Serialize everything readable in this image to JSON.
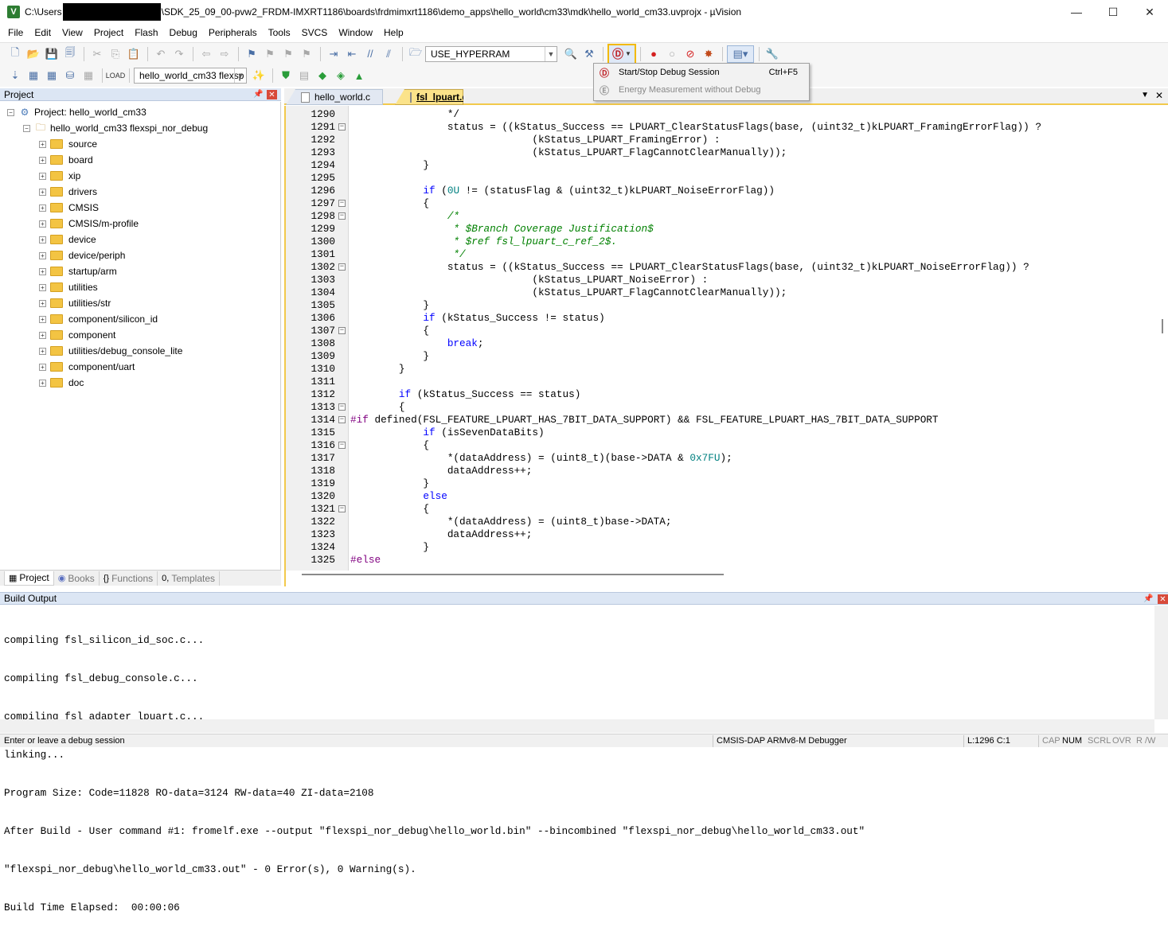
{
  "window": {
    "title_prefix": "C:\\Users",
    "title_suffix": "\\SDK_25_09_00-pvw2_FRDM-IMXRT1186\\boards\\frdmimxrt1186\\demo_apps\\hello_world\\cm33\\mdk\\hello_world_cm33.uvprojx - µVision",
    "icon": "V",
    "minimize": "—",
    "maximize": "☐",
    "close": "✕"
  },
  "menu": [
    "File",
    "Edit",
    "View",
    "Project",
    "Flash",
    "Debug",
    "Peripherals",
    "Tools",
    "SVCS",
    "Window",
    "Help"
  ],
  "toolbar": {
    "define_combo": "USE_HYPERRAM",
    "target_combo": "hello_world_cm33 flexsp"
  },
  "debug_menu": {
    "items": [
      {
        "label": "Start/Stop Debug Session",
        "shortcut": "Ctrl+F5"
      },
      {
        "label": "Energy Measurement without Debug",
        "shortcut": ""
      }
    ]
  },
  "project_panel": {
    "title": "Project",
    "project_label": "Project: hello_world_cm33",
    "target_label": "hello_world_cm33 flexspi_nor_debug",
    "groups": [
      "source",
      "board",
      "xip",
      "drivers",
      "CMSIS",
      "CMSIS/m-profile",
      "device",
      "device/periph",
      "startup/arm",
      "utilities",
      "utilities/str",
      "component/silicon_id",
      "component",
      "utilities/debug_console_lite",
      "component/uart",
      "doc"
    ],
    "tabs": [
      "Project",
      "Books",
      "Functions",
      "Templates"
    ]
  },
  "editor": {
    "tabs": [
      "hello_world.c",
      "fsl_lpuart.c"
    ],
    "lines": [
      {
        "n": "1290",
        "f": "",
        "h": [
          [
            "",
            "                */"
          ]
        ]
      },
      {
        "n": "1291",
        "f": "-",
        "h": [
          [
            "",
            "                status = ((kStatus_Success == LPUART_ClearStatusFlags(base, (uint32_t)kLPUART_FramingErrorFlag)) ?"
          ]
        ]
      },
      {
        "n": "1292",
        "f": "",
        "h": [
          [
            "",
            "                              (kStatus_LPUART_FramingError) :"
          ]
        ]
      },
      {
        "n": "1293",
        "f": "",
        "h": [
          [
            "",
            "                              (kStatus_LPUART_FlagCannotClearManually));"
          ]
        ]
      },
      {
        "n": "1294",
        "f": "",
        "h": [
          [
            "",
            "            }"
          ]
        ]
      },
      {
        "n": "1295",
        "f": "",
        "h": [
          [
            "",
            ""
          ]
        ]
      },
      {
        "n": "1296",
        "f": "",
        "h": [
          [
            "kw",
            "            if"
          ],
          [
            "",
            " ("
          ],
          [
            "num",
            "0U"
          ],
          [
            "",
            " != (statusFlag & (uint32_t)kLPUART_NoiseErrorFlag))"
          ]
        ]
      },
      {
        "n": "1297",
        "f": "-",
        "h": [
          [
            "",
            "            {"
          ]
        ]
      },
      {
        "n": "1298",
        "f": "-",
        "h": [
          [
            "cm",
            "                /*"
          ]
        ]
      },
      {
        "n": "1299",
        "f": "",
        "h": [
          [
            "cm",
            "                 * $Branch Coverage Justification$"
          ]
        ]
      },
      {
        "n": "1300",
        "f": "",
        "h": [
          [
            "cm",
            "                 * $ref fsl_lpuart_c_ref_2$."
          ]
        ]
      },
      {
        "n": "1301",
        "f": "",
        "h": [
          [
            "cm",
            "                 */"
          ]
        ]
      },
      {
        "n": "1302",
        "f": "-",
        "h": [
          [
            "",
            "                status = ((kStatus_Success == LPUART_ClearStatusFlags(base, (uint32_t)kLPUART_NoiseErrorFlag)) ?"
          ]
        ]
      },
      {
        "n": "1303",
        "f": "",
        "h": [
          [
            "",
            "                              (kStatus_LPUART_NoiseError) :"
          ]
        ]
      },
      {
        "n": "1304",
        "f": "",
        "h": [
          [
            "",
            "                              (kStatus_LPUART_FlagCannotClearManually));"
          ]
        ]
      },
      {
        "n": "1305",
        "f": "",
        "h": [
          [
            "",
            "            }"
          ]
        ]
      },
      {
        "n": "1306",
        "f": "",
        "h": [
          [
            "kw",
            "            if"
          ],
          [
            "",
            " (kStatus_Success != status)"
          ]
        ]
      },
      {
        "n": "1307",
        "f": "-",
        "h": [
          [
            "",
            "            {"
          ]
        ]
      },
      {
        "n": "1308",
        "f": "",
        "h": [
          [
            "kw",
            "                break"
          ],
          [
            "",
            ";"
          ]
        ]
      },
      {
        "n": "1309",
        "f": "",
        "h": [
          [
            "",
            "            }"
          ]
        ]
      },
      {
        "n": "1310",
        "f": "",
        "h": [
          [
            "",
            "        }"
          ]
        ]
      },
      {
        "n": "1311",
        "f": "",
        "h": [
          [
            "",
            ""
          ]
        ]
      },
      {
        "n": "1312",
        "f": "",
        "h": [
          [
            "kw",
            "        if"
          ],
          [
            "",
            " (kStatus_Success == status)"
          ]
        ]
      },
      {
        "n": "1313",
        "f": "-",
        "h": [
          [
            "",
            "        {"
          ]
        ]
      },
      {
        "n": "1314",
        "f": "-",
        "h": [
          [
            "pp",
            "#if"
          ],
          [
            "",
            " defined(FSL_FEATURE_LPUART_HAS_7BIT_DATA_SUPPORT) && FSL_FEATURE_LPUART_HAS_7BIT_DATA_SUPPORT"
          ]
        ]
      },
      {
        "n": "1315",
        "f": "",
        "h": [
          [
            "kw",
            "            if"
          ],
          [
            "",
            " (isSevenDataBits)"
          ]
        ]
      },
      {
        "n": "1316",
        "f": "-",
        "h": [
          [
            "",
            "            {"
          ]
        ]
      },
      {
        "n": "1317",
        "f": "",
        "h": [
          [
            "",
            "                *(dataAddress) = (uint8_t)(base->DATA & "
          ],
          [
            "num",
            "0x7FU"
          ],
          [
            "",
            ");"
          ]
        ]
      },
      {
        "n": "1318",
        "f": "",
        "h": [
          [
            "",
            "                dataAddress++;"
          ]
        ]
      },
      {
        "n": "1319",
        "f": "",
        "h": [
          [
            "",
            "            }"
          ]
        ]
      },
      {
        "n": "1320",
        "f": "",
        "h": [
          [
            "kw",
            "            else"
          ]
        ]
      },
      {
        "n": "1321",
        "f": "-",
        "h": [
          [
            "",
            "            {"
          ]
        ]
      },
      {
        "n": "1322",
        "f": "",
        "h": [
          [
            "",
            "                *(dataAddress) = (uint8_t)base->DATA;"
          ]
        ]
      },
      {
        "n": "1323",
        "f": "",
        "h": [
          [
            "",
            "                dataAddress++;"
          ]
        ]
      },
      {
        "n": "1324",
        "f": "",
        "h": [
          [
            "",
            "            }"
          ]
        ]
      },
      {
        "n": "1325",
        "f": "",
        "h": [
          [
            "pp",
            "#else"
          ]
        ]
      }
    ]
  },
  "build_output": {
    "title": "Build Output",
    "lines": [
      "compiling fsl_silicon_id_soc.c...",
      "compiling fsl_debug_console.c...",
      "compiling fsl_adapter_lpuart.c...",
      "linking...",
      "Program Size: Code=11828 RO-data=3124 RW-data=40 ZI-data=2108",
      "After Build - User command #1: fromelf.exe --output \"flexspi_nor_debug\\hello_world.bin\" --bincombined \"flexspi_nor_debug\\hello_world_cm33.out\"",
      "\"flexspi_nor_debug\\hello_world_cm33.out\" - 0 Error(s), 0 Warning(s).",
      "Build Time Elapsed:  00:00:06"
    ]
  },
  "status": {
    "message": "Enter or leave a debug session",
    "debugger": "CMSIS-DAP ARMv8-M Debugger",
    "position": "L:1296 C:1",
    "caps": "CAP",
    "num": "NUM",
    "scrl": "SCRL",
    "ovr": "OVR",
    "rw": "R /W"
  },
  "colors": {
    "accent_yellow": "#f2c94c",
    "keyword": "#0000ff",
    "comment": "#008000",
    "preprocessor": "#800080",
    "number": "#008080"
  }
}
